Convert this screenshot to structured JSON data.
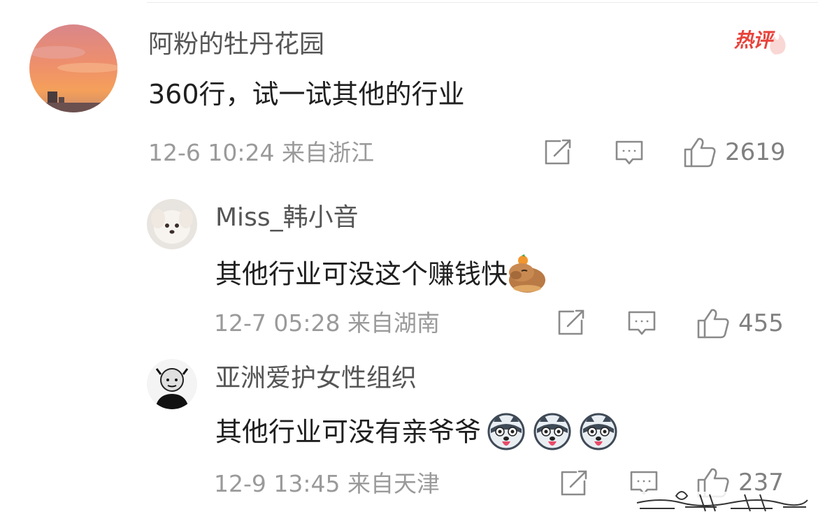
{
  "hot_badge": "热评",
  "comment": {
    "author": "阿粉的牡丹花园",
    "text": "360行，试一试其他的行业",
    "meta": "12-6 10:24 来自浙江",
    "likes": "2619"
  },
  "replies": [
    {
      "author": "Miss_韩小音",
      "text": "其他行业可没这个赚钱快",
      "emoji": "capybara-emoji",
      "meta": "12-7 05:28 来自湖南",
      "likes": "455"
    },
    {
      "author": "亚洲爱护女性组织",
      "text": "其他行业可没有亲爷爷",
      "emoji": "husky-emoji",
      "meta": "12-9 13:45 来自天津",
      "likes": "237"
    }
  ],
  "colors": {
    "accent_red": "#e8433b",
    "meta_gray": "#9a9a9a",
    "name_gray": "#555555"
  }
}
